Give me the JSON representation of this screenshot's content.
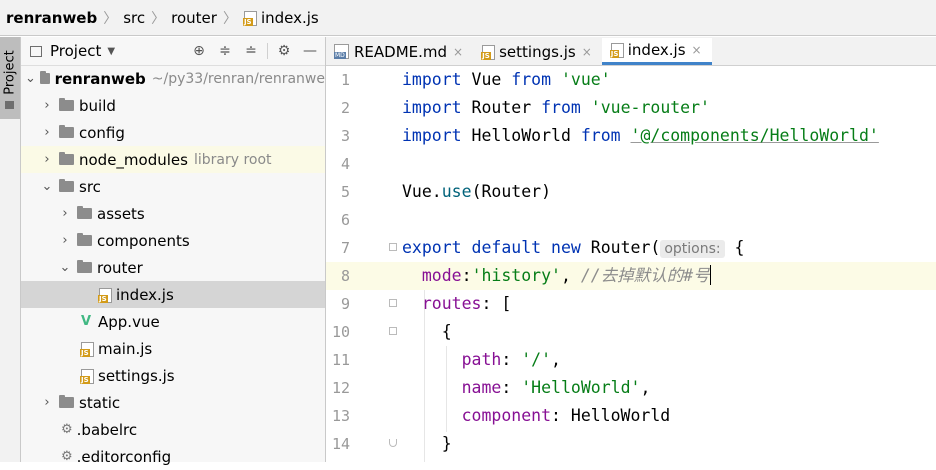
{
  "breadcrumb": {
    "project": "renranweb",
    "folder1": "src",
    "folder2": "router",
    "file": "index.js"
  },
  "tool_window": {
    "tab_label": "Project"
  },
  "project_panel": {
    "title": "Project",
    "tree": {
      "root": {
        "name": "renranweb",
        "path": "~/py33/renran/renranwe"
      },
      "items": [
        {
          "label": "build"
        },
        {
          "label": "config"
        },
        {
          "label": "node_modules",
          "note": "library root"
        },
        {
          "label": "src"
        },
        {
          "label": "assets"
        },
        {
          "label": "components"
        },
        {
          "label": "router"
        },
        {
          "label": "index.js"
        },
        {
          "label": "App.vue"
        },
        {
          "label": "main.js"
        },
        {
          "label": "settings.js"
        },
        {
          "label": "static"
        },
        {
          "label": ".babelrc"
        },
        {
          "label": ".editorconfig"
        }
      ]
    }
  },
  "editor_tabs": [
    {
      "label": "README.md"
    },
    {
      "label": "settings.js"
    },
    {
      "label": "index.js",
      "active": true
    }
  ],
  "editor": {
    "line_numbers": [
      "1",
      "2",
      "3",
      "4",
      "5",
      "6",
      "7",
      "8",
      "9",
      "10",
      "11",
      "12",
      "13",
      "14"
    ],
    "lines": {
      "l1": {
        "k1": "import",
        "t1": " Vue ",
        "k2": "from",
        "sp": " ",
        "s1": "'vue'"
      },
      "l2": {
        "k1": "import",
        "t1": " Router ",
        "k2": "from",
        "sp": " ",
        "s1": "'vue-router'"
      },
      "l3": {
        "k1": "import",
        "t1": " HelloWorld ",
        "k2": "from",
        "sp": " ",
        "s1": "'@/components/HelloWorld'"
      },
      "l5": {
        "t1": "Vue.",
        "f1": "use",
        "t2": "(Router)"
      },
      "l7": {
        "k1": "export",
        "sp1": " ",
        "k2": "default",
        "sp2": " ",
        "k3": "new",
        "t1": " Router(",
        "hint": "options:",
        "t2": " {"
      },
      "l8": {
        "indent": "  ",
        "p1": "mode",
        "t1": ":",
        "s1": "'history'",
        "t2": ", ",
        "c1": "//去掉默认的#号"
      },
      "l9": {
        "indent": "  ",
        "p1": "routes",
        "t1": ": ["
      },
      "l10": {
        "indent": "    ",
        "t1": "{"
      },
      "l11": {
        "indent": "      ",
        "p1": "path",
        "t1": ": ",
        "s1": "'/'",
        "t2": ","
      },
      "l12": {
        "indent": "      ",
        "p1": "name",
        "t1": ": ",
        "s1": "'HelloWorld'",
        "t2": ","
      },
      "l13": {
        "indent": "      ",
        "p1": "component",
        "t1": ": HelloWorld"
      },
      "l14": {
        "indent": "    ",
        "t1": "}"
      }
    }
  },
  "colors": {
    "keyword": "#0033b3",
    "string": "#067d17",
    "property": "#871094",
    "function": "#00627a",
    "comment": "#8c8c8c",
    "active_tab_underline": "#4083c9"
  }
}
